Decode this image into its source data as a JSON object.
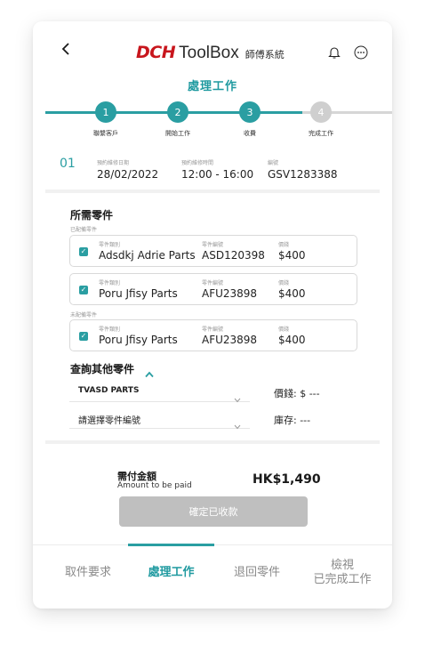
{
  "header": {
    "brand_dch": "DCH",
    "brand_toolbox": "ToolBox",
    "brand_sub": "師傅系統",
    "page_title": "處理工作",
    "icons": [
      "back-chevron-icon",
      "bell-icon",
      "more-icon"
    ]
  },
  "stepper": {
    "current": 3,
    "steps": [
      {
        "number": "1",
        "label": "聯繫客戶"
      },
      {
        "number": "2",
        "label": "開始工作"
      },
      {
        "number": "3",
        "label": "收費"
      },
      {
        "number": "4",
        "label": "完成工作"
      }
    ]
  },
  "appointment": {
    "index": "01",
    "date_label": "預約維修日期",
    "date": "28/02/2022",
    "time_label": "預約維修時間",
    "time": "12:00 - 16:00",
    "code_label": "編號",
    "code": "GSV1283388"
  },
  "parts": {
    "title": "所需零件",
    "assigned_label": "已配備零件",
    "unassigned_label": "未配備零件",
    "col_type": "零件類別",
    "col_code": "零件編號",
    "col_price": "價錢",
    "assigned": [
      {
        "type": "Adsdkj Adrie Parts",
        "code": "ASD120398",
        "price": "$400",
        "checked": true
      },
      {
        "type": "Poru Jfisy Parts",
        "code": "AFU23898",
        "price": "$400",
        "checked": true
      }
    ],
    "unassigned": [
      {
        "type": "Poru Jfisy Parts",
        "code": "AFU23898",
        "price": "$400",
        "checked": true
      }
    ]
  },
  "lookup": {
    "title": "查詢其他零件",
    "category_value": "TVASD PARTS",
    "code_placeholder": "請選擇零件編號",
    "price_text": "價錢: $ ---",
    "stock_text": "庫存: ---"
  },
  "payment": {
    "title": "需付金額",
    "subtitle": "Amount to be paid",
    "amount": "HK$1,490",
    "confirm_label": "確定已收款"
  },
  "tabs": [
    {
      "label": "取件要求",
      "active": false
    },
    {
      "label": "處理工作",
      "active": true
    },
    {
      "label": "退回零件",
      "active": false
    },
    {
      "label_line1": "檢視",
      "label_line2": "已完成工作",
      "active": false
    }
  ],
  "colors": {
    "accent": "#2a9ea2",
    "brand_red": "#c8161d",
    "disabled_button": "#bfbfbf",
    "inactive_step": "#cfcfcf"
  }
}
